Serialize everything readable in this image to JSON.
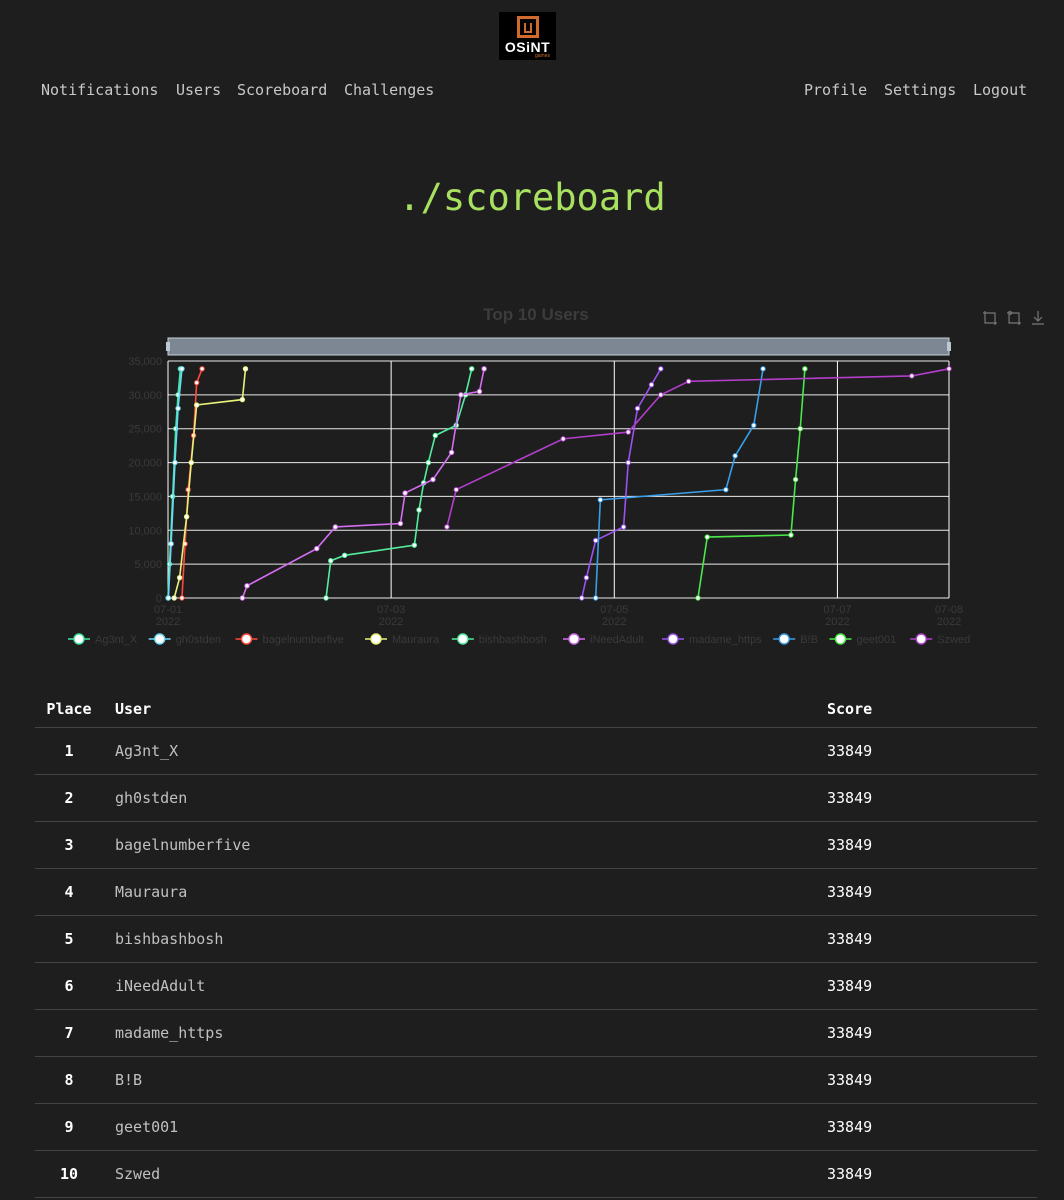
{
  "brand": {
    "logo_text": "OSiNT",
    "logo_sub": "games"
  },
  "nav": {
    "left": [
      "Notifications",
      "Users",
      "Scoreboard",
      "Challenges"
    ],
    "right": [
      "Profile",
      "Settings",
      "Logout"
    ]
  },
  "page_title": "./scoreboard",
  "toolbar_icons": [
    "zoom-icon",
    "restore-icon",
    "download-icon"
  ],
  "chart_data": {
    "type": "line",
    "title": "Top 10 Users",
    "xlabel": "",
    "ylabel": "",
    "ylim": [
      0,
      35000
    ],
    "yticks": [
      "0",
      "5,000",
      "10,000",
      "15,000",
      "20,000",
      "25,000",
      "30,000",
      "35,000"
    ],
    "xticks": [
      {
        "date": "2022-07-01",
        "label": "07-01",
        "sub": "2022"
      },
      {
        "date": "2022-07-03",
        "label": "07-03",
        "sub": "2022"
      },
      {
        "date": "2022-07-05",
        "label": "07-05",
        "sub": "2022"
      },
      {
        "date": "2022-07-07",
        "label": "07-07",
        "sub": "2022"
      },
      {
        "date": "2022-07-08",
        "label": "07-08",
        "sub": "2022"
      }
    ],
    "xlim": [
      "2022-07-01T00:00",
      "2022-07-08T00:00"
    ],
    "legend_position": "bottom",
    "grid": true,
    "series": [
      {
        "name": "Ag3nt_X",
        "color": "#3ee6a0",
        "points": [
          [
            "2022-07-01T00:00",
            0
          ],
          [
            "2022-07-01T00:20",
            5000
          ],
          [
            "2022-07-01T01:00",
            15000
          ],
          [
            "2022-07-01T01:40",
            25000
          ],
          [
            "2022-07-01T02:10",
            30000
          ],
          [
            "2022-07-01T02:40",
            33849
          ]
        ]
      },
      {
        "name": "gh0stden",
        "color": "#6ad8f5",
        "points": [
          [
            "2022-07-01T00:05",
            0
          ],
          [
            "2022-07-01T00:40",
            8000
          ],
          [
            "2022-07-01T01:30",
            20000
          ],
          [
            "2022-07-01T02:10",
            28000
          ],
          [
            "2022-07-01T03:00",
            33849
          ]
        ]
      },
      {
        "name": "bagelnumberfive",
        "color": "#ff4a3a",
        "points": [
          [
            "2022-07-01T03:00",
            0
          ],
          [
            "2022-07-01T03:40",
            8000
          ],
          [
            "2022-07-01T04:20",
            16000
          ],
          [
            "2022-07-01T05:30",
            24000
          ],
          [
            "2022-07-01T06:10",
            31800
          ],
          [
            "2022-07-01T07:20",
            33849
          ]
        ]
      },
      {
        "name": "Mauraura",
        "color": "#e7f27a",
        "points": [
          [
            "2022-07-01T01:20",
            0
          ],
          [
            "2022-07-01T02:30",
            3000
          ],
          [
            "2022-07-01T04:00",
            12000
          ],
          [
            "2022-07-01T05:00",
            20000
          ],
          [
            "2022-07-01T06:10",
            28500
          ],
          [
            "2022-07-01T16:00",
            29300
          ],
          [
            "2022-07-01T16:40",
            33849
          ]
        ]
      },
      {
        "name": "bishbashbosh",
        "color": "#52ee9e",
        "points": [
          [
            "2022-07-02T10:00",
            0
          ],
          [
            "2022-07-02T11:00",
            5500
          ],
          [
            "2022-07-02T14:00",
            6300
          ],
          [
            "2022-07-03T05:00",
            7800
          ],
          [
            "2022-07-03T06:00",
            13000
          ],
          [
            "2022-07-03T07:00",
            17000
          ],
          [
            "2022-07-03T08:00",
            20000
          ],
          [
            "2022-07-03T09:30",
            24000
          ],
          [
            "2022-07-03T14:00",
            25500
          ],
          [
            "2022-07-03T16:00",
            30000
          ],
          [
            "2022-07-03T17:20",
            33849
          ]
        ]
      },
      {
        "name": "iNeedAdult",
        "color": "#d46ef0",
        "points": [
          [
            "2022-07-01T16:00",
            0
          ],
          [
            "2022-07-01T17:00",
            1800
          ],
          [
            "2022-07-02T08:00",
            7300
          ],
          [
            "2022-07-02T12:00",
            10500
          ],
          [
            "2022-07-03T02:00",
            11000
          ],
          [
            "2022-07-03T03:00",
            15500
          ],
          [
            "2022-07-03T09:00",
            17500
          ],
          [
            "2022-07-03T13:00",
            21500
          ],
          [
            "2022-07-03T15:00",
            30000
          ],
          [
            "2022-07-03T19:00",
            30500
          ],
          [
            "2022-07-03T20:00",
            33849
          ]
        ]
      },
      {
        "name": "madame_https",
        "color": "#9a52f0",
        "points": [
          [
            "2022-07-04T17:00",
            0
          ],
          [
            "2022-07-04T18:00",
            3000
          ],
          [
            "2022-07-04T20:00",
            8500
          ],
          [
            "2022-07-05T02:00",
            10500
          ],
          [
            "2022-07-05T03:00",
            20000
          ],
          [
            "2022-07-05T05:00",
            28000
          ],
          [
            "2022-07-05T08:00",
            31500
          ],
          [
            "2022-07-05T10:00",
            33849
          ]
        ]
      },
      {
        "name": "B!B",
        "color": "#3a9ee8",
        "points": [
          [
            "2022-07-04T20:00",
            0
          ],
          [
            "2022-07-04T21:00",
            14500
          ],
          [
            "2022-07-06T00:00",
            16000
          ],
          [
            "2022-07-06T02:00",
            21000
          ],
          [
            "2022-07-06T06:00",
            25500
          ],
          [
            "2022-07-06T08:00",
            33849
          ]
        ]
      },
      {
        "name": "geet001",
        "color": "#4ce84a",
        "points": [
          [
            "2022-07-05T18:00",
            0
          ],
          [
            "2022-07-05T20:00",
            9000
          ],
          [
            "2022-07-06T14:00",
            9300
          ],
          [
            "2022-07-06T15:00",
            17500
          ],
          [
            "2022-07-06T16:00",
            25000
          ],
          [
            "2022-07-06T17:00",
            33849
          ]
        ]
      },
      {
        "name": "Szwed",
        "color": "#b33ecb",
        "points": [
          [
            "2022-07-03T12:00",
            10500
          ],
          [
            "2022-07-03T14:00",
            16000
          ],
          [
            "2022-07-04T13:00",
            23500
          ],
          [
            "2022-07-05T03:00",
            24500
          ],
          [
            "2022-07-05T10:00",
            30000
          ],
          [
            "2022-07-05T16:00",
            32000
          ],
          [
            "2022-07-07T16:00",
            32800
          ],
          [
            "2022-07-08T00:00",
            33849
          ]
        ]
      }
    ]
  },
  "table": {
    "headers": {
      "place": "Place",
      "user": "User",
      "score": "Score"
    },
    "rows": [
      {
        "place": "1",
        "user": "Ag3nt_X",
        "score": "33849"
      },
      {
        "place": "2",
        "user": "gh0stden",
        "score": "33849"
      },
      {
        "place": "3",
        "user": "bagelnumberfive",
        "score": "33849"
      },
      {
        "place": "4",
        "user": "Mauraura",
        "score": "33849"
      },
      {
        "place": "5",
        "user": "bishbashbosh",
        "score": "33849"
      },
      {
        "place": "6",
        "user": "iNeedAdult",
        "score": "33849"
      },
      {
        "place": "7",
        "user": "madame_https",
        "score": "33849"
      },
      {
        "place": "8",
        "user": "B!B",
        "score": "33849"
      },
      {
        "place": "9",
        "user": "geet001",
        "score": "33849"
      },
      {
        "place": "10",
        "user": "Szwed",
        "score": "33849"
      }
    ]
  }
}
